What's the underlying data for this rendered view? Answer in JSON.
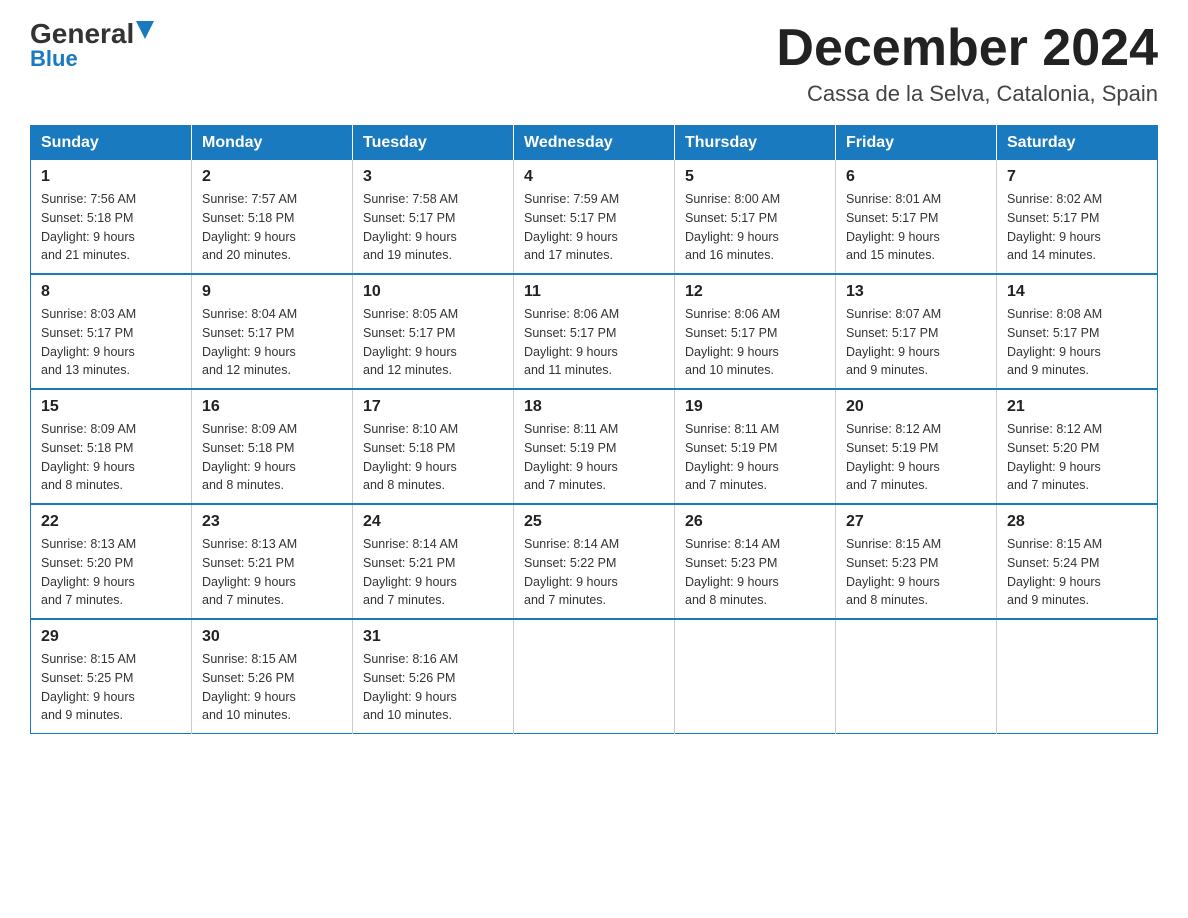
{
  "header": {
    "logo_general": "General",
    "logo_blue": "Blue",
    "title": "December 2024",
    "subtitle": "Cassa de la Selva, Catalonia, Spain"
  },
  "days_of_week": [
    "Sunday",
    "Monday",
    "Tuesday",
    "Wednesday",
    "Thursday",
    "Friday",
    "Saturday"
  ],
  "weeks": [
    [
      {
        "day": "1",
        "sunrise": "7:56 AM",
        "sunset": "5:18 PM",
        "daylight": "9 hours and 21 minutes."
      },
      {
        "day": "2",
        "sunrise": "7:57 AM",
        "sunset": "5:18 PM",
        "daylight": "9 hours and 20 minutes."
      },
      {
        "day": "3",
        "sunrise": "7:58 AM",
        "sunset": "5:17 PM",
        "daylight": "9 hours and 19 minutes."
      },
      {
        "day": "4",
        "sunrise": "7:59 AM",
        "sunset": "5:17 PM",
        "daylight": "9 hours and 17 minutes."
      },
      {
        "day": "5",
        "sunrise": "8:00 AM",
        "sunset": "5:17 PM",
        "daylight": "9 hours and 16 minutes."
      },
      {
        "day": "6",
        "sunrise": "8:01 AM",
        "sunset": "5:17 PM",
        "daylight": "9 hours and 15 minutes."
      },
      {
        "day": "7",
        "sunrise": "8:02 AM",
        "sunset": "5:17 PM",
        "daylight": "9 hours and 14 minutes."
      }
    ],
    [
      {
        "day": "8",
        "sunrise": "8:03 AM",
        "sunset": "5:17 PM",
        "daylight": "9 hours and 13 minutes."
      },
      {
        "day": "9",
        "sunrise": "8:04 AM",
        "sunset": "5:17 PM",
        "daylight": "9 hours and 12 minutes."
      },
      {
        "day": "10",
        "sunrise": "8:05 AM",
        "sunset": "5:17 PM",
        "daylight": "9 hours and 12 minutes."
      },
      {
        "day": "11",
        "sunrise": "8:06 AM",
        "sunset": "5:17 PM",
        "daylight": "9 hours and 11 minutes."
      },
      {
        "day": "12",
        "sunrise": "8:06 AM",
        "sunset": "5:17 PM",
        "daylight": "9 hours and 10 minutes."
      },
      {
        "day": "13",
        "sunrise": "8:07 AM",
        "sunset": "5:17 PM",
        "daylight": "9 hours and 9 minutes."
      },
      {
        "day": "14",
        "sunrise": "8:08 AM",
        "sunset": "5:17 PM",
        "daylight": "9 hours and 9 minutes."
      }
    ],
    [
      {
        "day": "15",
        "sunrise": "8:09 AM",
        "sunset": "5:18 PM",
        "daylight": "9 hours and 8 minutes."
      },
      {
        "day": "16",
        "sunrise": "8:09 AM",
        "sunset": "5:18 PM",
        "daylight": "9 hours and 8 minutes."
      },
      {
        "day": "17",
        "sunrise": "8:10 AM",
        "sunset": "5:18 PM",
        "daylight": "9 hours and 8 minutes."
      },
      {
        "day": "18",
        "sunrise": "8:11 AM",
        "sunset": "5:19 PM",
        "daylight": "9 hours and 7 minutes."
      },
      {
        "day": "19",
        "sunrise": "8:11 AM",
        "sunset": "5:19 PM",
        "daylight": "9 hours and 7 minutes."
      },
      {
        "day": "20",
        "sunrise": "8:12 AM",
        "sunset": "5:19 PM",
        "daylight": "9 hours and 7 minutes."
      },
      {
        "day": "21",
        "sunrise": "8:12 AM",
        "sunset": "5:20 PM",
        "daylight": "9 hours and 7 minutes."
      }
    ],
    [
      {
        "day": "22",
        "sunrise": "8:13 AM",
        "sunset": "5:20 PM",
        "daylight": "9 hours and 7 minutes."
      },
      {
        "day": "23",
        "sunrise": "8:13 AM",
        "sunset": "5:21 PM",
        "daylight": "9 hours and 7 minutes."
      },
      {
        "day": "24",
        "sunrise": "8:14 AM",
        "sunset": "5:21 PM",
        "daylight": "9 hours and 7 minutes."
      },
      {
        "day": "25",
        "sunrise": "8:14 AM",
        "sunset": "5:22 PM",
        "daylight": "9 hours and 7 minutes."
      },
      {
        "day": "26",
        "sunrise": "8:14 AM",
        "sunset": "5:23 PM",
        "daylight": "9 hours and 8 minutes."
      },
      {
        "day": "27",
        "sunrise": "8:15 AM",
        "sunset": "5:23 PM",
        "daylight": "9 hours and 8 minutes."
      },
      {
        "day": "28",
        "sunrise": "8:15 AM",
        "sunset": "5:24 PM",
        "daylight": "9 hours and 9 minutes."
      }
    ],
    [
      {
        "day": "29",
        "sunrise": "8:15 AM",
        "sunset": "5:25 PM",
        "daylight": "9 hours and 9 minutes."
      },
      {
        "day": "30",
        "sunrise": "8:15 AM",
        "sunset": "5:26 PM",
        "daylight": "9 hours and 10 minutes."
      },
      {
        "day": "31",
        "sunrise": "8:16 AM",
        "sunset": "5:26 PM",
        "daylight": "9 hours and 10 minutes."
      },
      null,
      null,
      null,
      null
    ]
  ],
  "labels": {
    "sunrise": "Sunrise:",
    "sunset": "Sunset:",
    "daylight": "Daylight:"
  }
}
